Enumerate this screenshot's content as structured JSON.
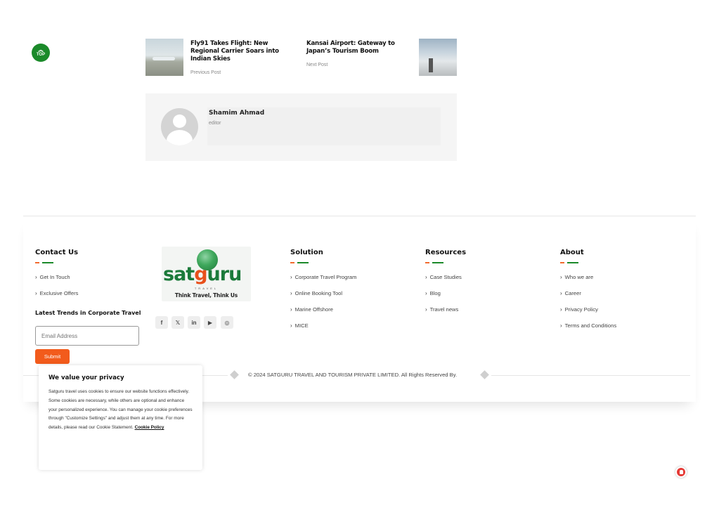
{
  "top_button": {
    "label": "TOP",
    "icon": "double-chevron-up-icon"
  },
  "post_nav": {
    "prev": {
      "title": "Fly91 Takes Flight: New Regional Carrier Soars into Indian Skies",
      "label": "Previous Post"
    },
    "next": {
      "title": "Kansai Airport: Gateway to Japan’s Tourism Boom",
      "label": "Next Post"
    }
  },
  "author": {
    "name": "Shamim Ahmad",
    "role": "editor"
  },
  "footer": {
    "contact": {
      "title": "Contact Us",
      "links": [
        "Get In Touch",
        "Exclusive Offers"
      ],
      "newsletter_title": "Latest Trends in Corporate Travel",
      "email_placeholder": "Email Address",
      "submit_label": "Submit"
    },
    "logo": {
      "text_a": "sat",
      "text_o": "g",
      "text_b": "uru",
      "sub": "TRAVEL",
      "tagline": "Think Travel, Think Us"
    },
    "social": [
      {
        "name": "facebook-icon",
        "glyph": "f"
      },
      {
        "name": "x-twitter-icon",
        "glyph": "𝕏"
      },
      {
        "name": "linkedin-icon",
        "glyph": "in"
      },
      {
        "name": "youtube-icon",
        "glyph": "▶"
      },
      {
        "name": "instagram-icon",
        "glyph": "◎"
      }
    ],
    "solution": {
      "title": "Solution",
      "links": [
        "Corporate Travel Program",
        "Online Booking Tool",
        "Marine Offshore",
        "MICE"
      ]
    },
    "resources": {
      "title": "Resources",
      "links": [
        "Case Studies",
        "Blog",
        "Travel news"
      ]
    },
    "about": {
      "title": "About",
      "links": [
        "Who we are",
        "Career",
        "Privacy Policy",
        "Terms and Conditions"
      ]
    },
    "copyright": "© 2024 SATGURU TRAVEL AND TOURISM PRIVATE LIMITED. All Rights Reserved By."
  },
  "cookie": {
    "title": "We value your privacy",
    "body": "Satguru travel uses cookies to ensure our website functions effectively. Some cookies are necessary, while others are optional and enhance your personalized experience. You can manage your cookie preferences through \"Customize Settings\" and adjust them at any time. For more details, please read our Cookie Statement.",
    "link": "Cookie Policy"
  },
  "colors": {
    "brand_green": "#1b8a2a",
    "brand_orange": "#f25b1c",
    "notification_red": "#e53935"
  }
}
